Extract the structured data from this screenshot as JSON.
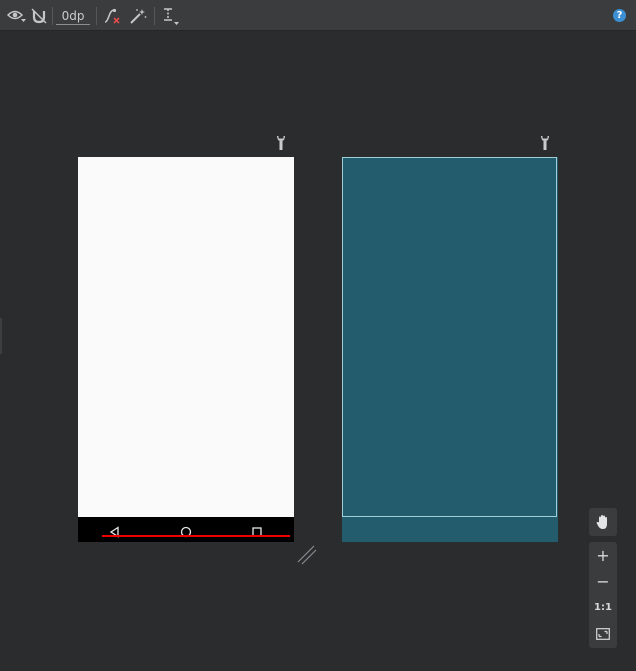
{
  "toolbar": {
    "margin_value": "0dp",
    "help_label": "?",
    "icons": [
      "eye-icon",
      "magnet-off-icon",
      "clear-constraints-icon",
      "magic-wand-icon",
      "guidelines-icon",
      "help-icon"
    ]
  },
  "zoom": {
    "zoom_in": "+",
    "zoom_out": "−",
    "actual_size": "1:1"
  },
  "colors": {
    "blueprint": "#235d6d",
    "design_bg": "#fafafa",
    "nav_accent": "#ee0000",
    "canvas": "#2b2c2e"
  }
}
